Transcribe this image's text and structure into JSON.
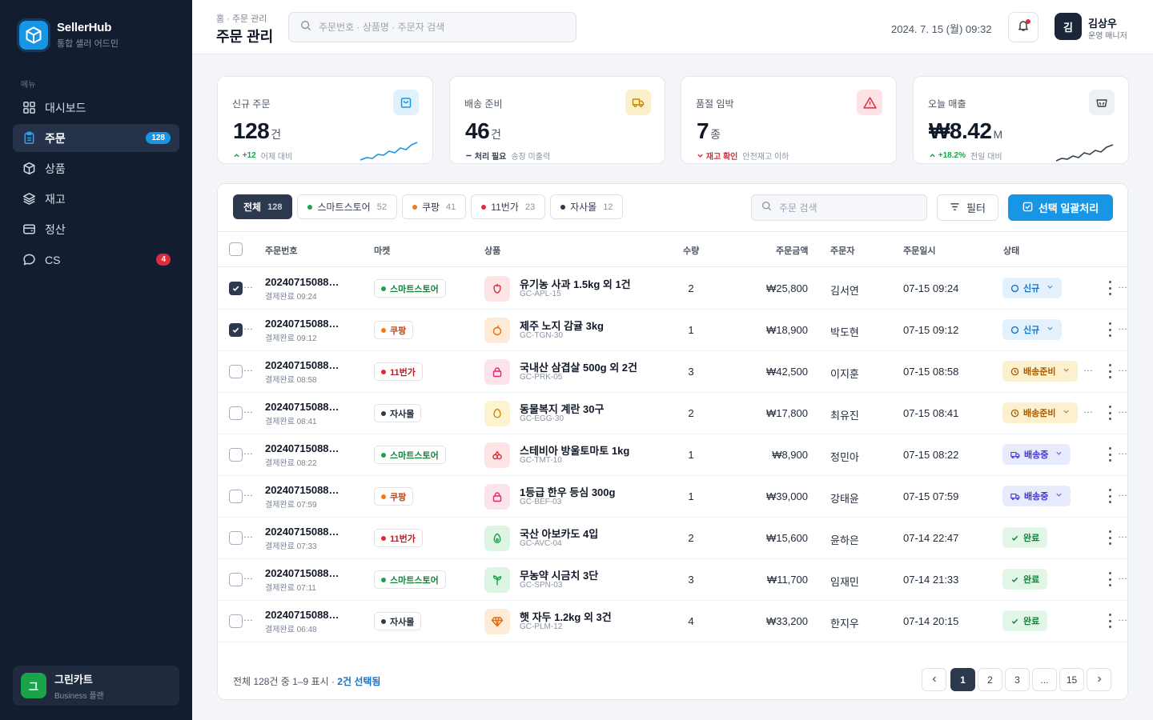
{
  "brand": {
    "name": "SellerHub",
    "subtitle": "통합 셀러 어드민"
  },
  "sidebar": {
    "caption": "메뉴",
    "items": [
      {
        "label": "대시보드",
        "icon": "dashboard-grid-icon"
      },
      {
        "label": "주문",
        "icon": "clipboard-icon",
        "badge": "128",
        "active": true
      },
      {
        "label": "상품",
        "icon": "box-icon"
      },
      {
        "label": "재고",
        "icon": "layers-icon"
      },
      {
        "label": "정산",
        "icon": "wallet-icon"
      },
      {
        "label": "CS",
        "icon": "chat-bubble-icon",
        "badge": "4"
      }
    ],
    "store": {
      "avatar": "그",
      "name": "그린카트",
      "plan": "Business 플랜"
    }
  },
  "header": {
    "breadcrumb": "홈 · 주문 관리",
    "title": "주문 관리",
    "search_placeholder": "주문번호 · 상품명 · 주문자 검색",
    "datetime": "2024. 7. 15 (월) 09:32",
    "user": {
      "avatar": "김",
      "name": "김상우",
      "role": "운영 매니저"
    }
  },
  "kpis": [
    {
      "label": "신규 주문",
      "value": "128",
      "unit": "건",
      "delta": "+12",
      "delta_note": "어제 대비",
      "trend": "up",
      "accent": "#1796e6"
    },
    {
      "label": "배송 준비",
      "value": "46",
      "unit": "건",
      "delta": "처리 필요",
      "delta_note": "송장 미출력",
      "trend": "flat",
      "accent": "#d99a0b"
    },
    {
      "label": "품절 임박",
      "value": "7",
      "unit": "종",
      "delta": "재고 확인",
      "delta_note": "안전재고 이하",
      "trend": "down",
      "accent": "#dc2b3a"
    },
    {
      "label": "오늘 매출",
      "value": "₩8.42",
      "unit": "M",
      "delta": "+18.2%",
      "delta_note": "전일 대비",
      "trend": "up",
      "accent": "#4b5563"
    }
  ],
  "orders": {
    "tabs": [
      {
        "label": "전체",
        "count": "128",
        "active": true
      },
      {
        "label": "스마트스토어",
        "count": "52",
        "dot": "#1aa34a"
      },
      {
        "label": "쿠팡",
        "count": "41",
        "dot": "#f07a1a"
      },
      {
        "label": "11번가",
        "count": "23",
        "dot": "#e5293b"
      },
      {
        "label": "자사몰",
        "count": "12",
        "dot": "#2c394f"
      }
    ],
    "search_placeholder": "주문 검색",
    "filter_label": "필터",
    "bulk_label": "선택 일괄처리",
    "columns": [
      "주문번호",
      "마켓",
      "상품",
      "수량",
      "주문금액",
      "주문자",
      "주문일시",
      "상태"
    ],
    "rows": [
      {
        "checked": true,
        "order_no": "20240715088…",
        "sub": "결제완료 09:24",
        "market": "스마트스토어",
        "product": "유기농 사과 1.5kg 외 1건",
        "code": "GC-APL-15",
        "qty": "2",
        "amount": "₩25,800",
        "buyer": "김서연",
        "date": "07-15 09:24",
        "status": "신규"
      },
      {
        "checked": true,
        "order_no": "20240715088…",
        "sub": "결제완료 09:12",
        "market": "쿠팡",
        "product": "제주 노지 감귤 3kg",
        "code": "GC-TGN-30",
        "qty": "1",
        "amount": "₩18,900",
        "buyer": "박도현",
        "date": "07-15 09:12",
        "status": "신규"
      },
      {
        "checked": false,
        "order_no": "20240715088…",
        "sub": "결제완료 08:58",
        "market": "11번가",
        "product": "국내산 삼겹살 500g 외 2건",
        "code": "GC-PRK-05",
        "qty": "3",
        "amount": "₩42,500",
        "buyer": "이지훈",
        "date": "07-15 08:58",
        "status": "배송준비"
      },
      {
        "checked": false,
        "order_no": "20240715088…",
        "sub": "결제완료 08:41",
        "market": "자사몰",
        "product": "동물복지 계란 30구",
        "code": "GC-EGG-30",
        "qty": "2",
        "amount": "₩17,800",
        "buyer": "최유진",
        "date": "07-15 08:41",
        "status": "배송준비"
      },
      {
        "checked": false,
        "order_no": "20240715088…",
        "sub": "결제완료 08:22",
        "market": "스마트스토어",
        "product": "스테비아 방울토마토 1kg",
        "code": "GC-TMT-10",
        "qty": "1",
        "amount": "₩8,900",
        "buyer": "정민아",
        "date": "07-15 08:22",
        "status": "배송중"
      },
      {
        "checked": false,
        "order_no": "20240715088…",
        "sub": "결제완료 07:59",
        "market": "쿠팡",
        "product": "1등급 한우 등심 300g",
        "code": "GC-BEF-03",
        "qty": "1",
        "amount": "₩39,000",
        "buyer": "강태윤",
        "date": "07-15 07:59",
        "status": "배송중"
      },
      {
        "checked": false,
        "order_no": "20240715088…",
        "sub": "결제완료 07:33",
        "market": "11번가",
        "product": "국산 아보카도 4입",
        "code": "GC-AVC-04",
        "qty": "2",
        "amount": "₩15,600",
        "buyer": "윤하은",
        "date": "07-14 22:47",
        "status": "완료"
      },
      {
        "checked": false,
        "order_no": "20240715088…",
        "sub": "결제완료 07:11",
        "market": "스마트스토어",
        "product": "무농약 시금치 3단",
        "code": "GC-SPN-03",
        "qty": "3",
        "amount": "₩11,700",
        "buyer": "임재민",
        "date": "07-14 21:33",
        "status": "완료"
      },
      {
        "checked": false,
        "order_no": "20240715088…",
        "sub": "결제완료 06:48",
        "market": "자사몰",
        "product": "햇 자두 1.2kg 외 3건",
        "code": "GC-PLM-12",
        "qty": "4",
        "amount": "₩33,200",
        "buyer": "한지우",
        "date": "07-14 20:15",
        "status": "완료"
      }
    ],
    "summary": "전체 128건 중 1–9 표시 ·",
    "selected": "2건 선택됨",
    "pages": [
      "1",
      "2",
      "3",
      "...",
      "15"
    ],
    "current_page": "1"
  }
}
